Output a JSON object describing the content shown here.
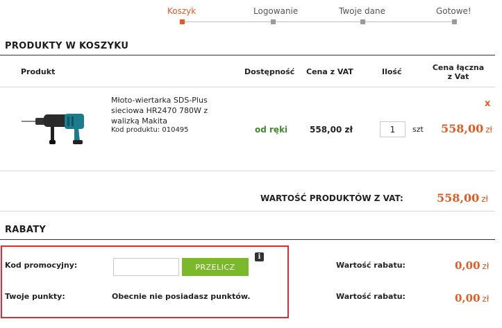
{
  "steps": [
    {
      "label": "Koszyk",
      "active": true
    },
    {
      "label": "Logowanie",
      "active": false
    },
    {
      "label": "Twoje dane",
      "active": false
    },
    {
      "label": "Gotowe!",
      "active": false
    }
  ],
  "cart": {
    "title": "PRODUKTY W KOSZYKU",
    "headers": {
      "product": "Produkt",
      "availability": "Dostępność",
      "price": "Cena z VAT",
      "quantity": "Ilość",
      "total_line1": "Cena łączna",
      "total_line2": "z Vat"
    },
    "items": [
      {
        "name": "Młoto-wiertarka SDS-Plus sieciowa HR2470 780W z walizką Makita",
        "code_label": "Kod produktu:",
        "code": "010495",
        "availability": "od ręki",
        "price": "558,00 zł",
        "quantity": "1",
        "unit": "szt",
        "total": "558,00",
        "currency": "zł",
        "remove": "x"
      }
    ],
    "sum_label": "WARTOŚĆ PRODUKTÓW Z VAT:",
    "sum_amount": "558,00",
    "sum_currency": "zł"
  },
  "discounts": {
    "title": "RABATY",
    "promo_label": "Kod promocyjny:",
    "promo_value": "",
    "recalc_label": "PRZELICZ",
    "info_icon": "i",
    "points_label": "Twoje punkty:",
    "points_text": "Obecnie nie posiadasz punktów.",
    "rabat_label_1": "Wartość rabatu:",
    "rabat_value_1": "0,00",
    "rabat_label_2": "Wartość rabatu:",
    "rabat_value_2": "0,00",
    "currency": "zł"
  },
  "colors": {
    "accent": "#e35a22",
    "available": "#3d8b2a",
    "button": "#7cb82b",
    "highlight_border": "#e22a35"
  }
}
